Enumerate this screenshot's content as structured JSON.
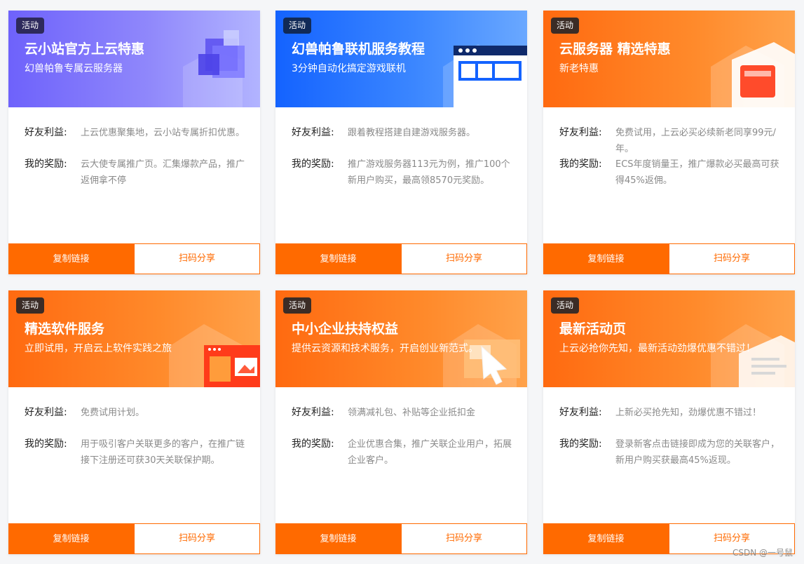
{
  "colors": {
    "accent": "#ff6a00",
    "badge_dark": "#3b2c26",
    "text_muted": "#8a8a8a"
  },
  "cards": [
    {
      "badge": "活动",
      "title": "云小站官方上云特惠",
      "subtitle": "幻兽帕鲁专属云服务器",
      "theme": "purple",
      "friend_label": "好友利益:",
      "friend_value": "上云优惠聚集地，云小站专属折扣优惠。",
      "reward_label": "我的奖励:",
      "reward_value": "云大使专属推广页。汇集爆款产品，推广返佣拿不停",
      "copy_label": "复制链接",
      "share_label": "扫码分享"
    },
    {
      "badge": "活动",
      "title": "幻兽帕鲁联机服务教程",
      "subtitle": "3分钟自动化搞定游戏联机",
      "theme": "blue",
      "friend_label": "好友利益:",
      "friend_value": "跟着教程搭建自建游戏服务器。",
      "reward_label": "我的奖励:",
      "reward_value": "推广游戏服务器113元为例，推广100个新用户购买，最高领8570元奖励。",
      "copy_label": "复制链接",
      "share_label": "扫码分享"
    },
    {
      "badge": "活动",
      "title": "云服务器 精选特惠",
      "subtitle": "新老特惠",
      "theme": "orange",
      "friend_label": "好友利益:",
      "friend_value": "免费试用，上云必买必续新老同享99元/年。",
      "reward_label": "我的奖励:",
      "reward_value": "ECS年度销量王，推广爆款必买最高可获得45%返佣。",
      "copy_label": "复制链接",
      "share_label": "扫码分享"
    },
    {
      "badge": "活动",
      "title": "精选软件服务",
      "subtitle": "立即试用，开启云上软件实践之旅",
      "theme": "orange",
      "friend_label": "好友利益:",
      "friend_value": "免费试用计划。",
      "reward_label": "我的奖励:",
      "reward_value": "用于吸引客户关联更多的客户，在推广链接下注册还可获30天关联保护期。",
      "copy_label": "复制链接",
      "share_label": "扫码分享"
    },
    {
      "badge": "活动",
      "title": "中小企业扶持权益",
      "subtitle": "提供云资源和技术服务，开启创业新范式。",
      "theme": "orange",
      "friend_label": "好友利益:",
      "friend_value": "领满减礼包、补贴等企业抵扣金",
      "reward_label": "我的奖励:",
      "reward_value": "企业优惠合集，推广关联企业用户，拓展企业客户。",
      "copy_label": "复制链接",
      "share_label": "扫码分享"
    },
    {
      "badge": "活动",
      "title": "最新活动页",
      "subtitle": "上云必抢你先知，最新活动劲爆优惠不错过！",
      "theme": "orange",
      "friend_label": "好友利益:",
      "friend_value": "上新必买抢先知，劲爆优惠不错过！",
      "reward_label": "我的奖励:",
      "reward_value": "登录新客点击链接即成为您的关联客户，新用户购买获最高45%返现。",
      "copy_label": "复制链接",
      "share_label": "扫码分享"
    }
  ],
  "watermark": "CSDN @一号鼠"
}
